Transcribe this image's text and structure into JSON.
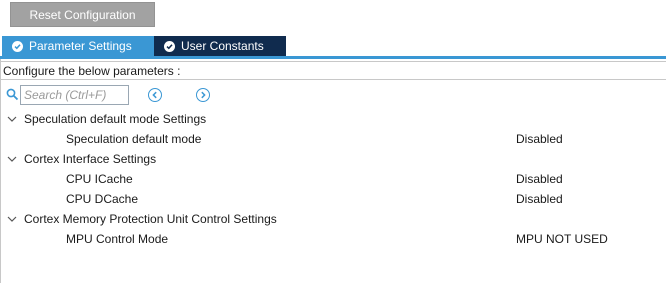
{
  "toolbar": {
    "reset_label": "Reset Configuration"
  },
  "tabs": [
    {
      "label": "Parameter Settings",
      "active": true
    },
    {
      "label": "User Constants",
      "active": false
    }
  ],
  "configure_text": "Configure the below parameters :",
  "search": {
    "placeholder": "Search (Ctrl+F)",
    "value": ""
  },
  "groups": [
    {
      "title": "Speculation default mode Settings",
      "params": [
        {
          "name": "Speculation default mode",
          "value": "Disabled"
        }
      ]
    },
    {
      "title": "Cortex Interface Settings",
      "params": [
        {
          "name": "CPU ICache",
          "value": "Disabled"
        },
        {
          "name": "CPU DCache",
          "value": "Disabled"
        }
      ]
    },
    {
      "title": "Cortex Memory Protection Unit Control Settings",
      "params": [
        {
          "name": "MPU Control Mode",
          "value": "MPU NOT USED"
        }
      ]
    }
  ],
  "colors": {
    "accent": "#3a97d4",
    "tab_inactive": "#102b4e",
    "reset_button": "#a2a2a2"
  },
  "icons": {
    "tab": "check-circle-icon",
    "search": "search-icon",
    "prev": "chevron-left-circle-icon",
    "next": "chevron-right-circle-icon",
    "expand": "chevron-down-icon"
  }
}
